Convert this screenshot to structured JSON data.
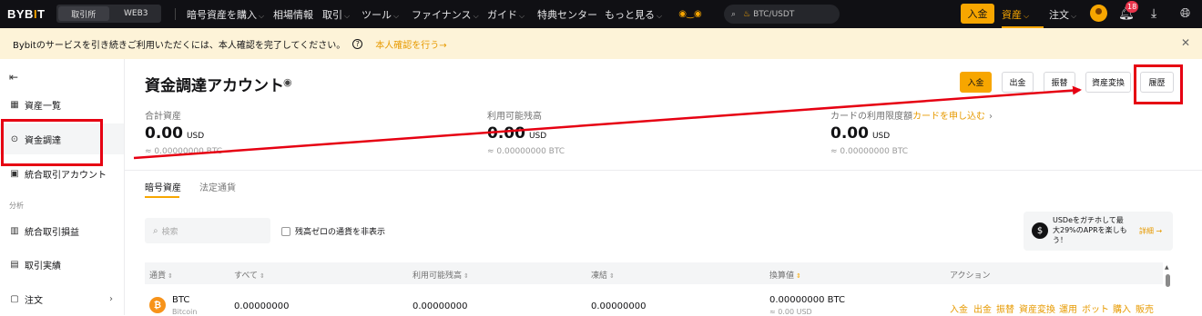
{
  "topnav": {
    "logo": "BYB",
    "logo_i": "I",
    "logo_t": "T",
    "segments": [
      "取引所",
      "WEB3"
    ],
    "items": [
      "暗号資産を購入",
      "相場情報",
      "取引",
      "ツール",
      "ファイナンス",
      "ガイド",
      "特典センター",
      "もっと見る"
    ],
    "search_placeholder": "BTC/USDT",
    "deposit_label": "入金",
    "assets_label": "資産",
    "orders_label": "注文",
    "notification_count": "18",
    "accent_color": "#f7a600"
  },
  "banner": {
    "message": "Bybitのサービスを引き続きご利用いただくには、本人確認を完了してください。",
    "link_label": "本人確認を行う",
    "link_arrow": "→"
  },
  "sidebar": {
    "items": [
      {
        "label": "資産一覧",
        "icon": "grid-icon"
      },
      {
        "label": "資金調達",
        "icon": "coin-circle-icon"
      },
      {
        "label": "統合取引アカウント",
        "icon": "wallet-icon"
      },
      {
        "label": "統合取引損益",
        "icon": "bar-chart-icon"
      },
      {
        "label": "取引実績",
        "icon": "record-icon"
      },
      {
        "label": "注文",
        "icon": "document-icon"
      }
    ],
    "section_analysis": "分析"
  },
  "main": {
    "title": "資金調達アカウント",
    "actions": [
      "入金",
      "出金",
      "振替",
      "資産変換",
      "履歴"
    ],
    "stats": [
      {
        "label": "合計資産",
        "value": "0.00",
        "unit": "USD",
        "sub": "≈ 0.00000000 BTC"
      },
      {
        "label": "利用可能残高",
        "value": "0.00",
        "unit": "USD",
        "sub": "≈ 0.00000000 BTC"
      },
      {
        "label": "カードの利用限度額",
        "link": "カードを申し込む",
        "value": "0.00",
        "unit": "USD",
        "sub": "≈ 0.00000000 BTC"
      }
    ],
    "tabs": [
      "暗号資産",
      "法定通貨"
    ],
    "search_placeholder": "検索",
    "hide_zero_label": "残高ゼロの通貨を非表示",
    "promo": {
      "text": "USDeをガチホして最大29%のAPRを楽しもう！",
      "link": "詳細"
    },
    "table": {
      "headers": [
        "通貨",
        "すべて",
        "利用可能残高",
        "凍結",
        "換算値",
        "アクション"
      ],
      "rows": [
        {
          "coin": "BTC",
          "coin_name": "Bitcoin",
          "total": "0.00000000",
          "available": "0.00000000",
          "frozen": "0.00000000",
          "value_btc": "0.00000000 BTC",
          "value_usd": "≈ 0.00 USD",
          "actions": [
            "入金",
            "出金",
            "振替",
            "資産変換",
            "運用",
            "ボット",
            "購入",
            "販売"
          ]
        }
      ]
    }
  },
  "annotation": {
    "color": "#e60012"
  }
}
